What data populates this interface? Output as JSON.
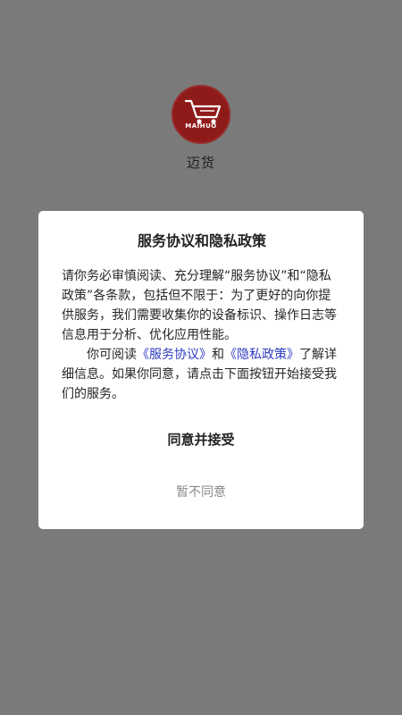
{
  "app": {
    "name": "迈货",
    "logo_text": "MAIHUO"
  },
  "dialog": {
    "title": "服务协议和隐私政策",
    "paragraph1": "请你务必审慎阅读、充分理解“服务协议”和“隐私政策”各条款，包括但不限于：为了更好的向你提供服务，我们需要收集你的设备标识、操作日志等信息用于分析、优化应用性能。",
    "paragraph2_prefix": "你可阅读",
    "service_link": "《服务协议》",
    "paragraph2_and": "和",
    "privacy_link": "《隐私政策》",
    "paragraph2_suffix": "了解详细信息。如果你同意，请点击下面按钮开始接受我们的服务。",
    "accept_label": "同意并接受",
    "decline_label": "暂不同意"
  },
  "colors": {
    "backdrop": "#7a7a7a",
    "logo_red": "#8f1a1a",
    "link": "#2d3bc0",
    "decline_text": "#8a8a8a"
  }
}
